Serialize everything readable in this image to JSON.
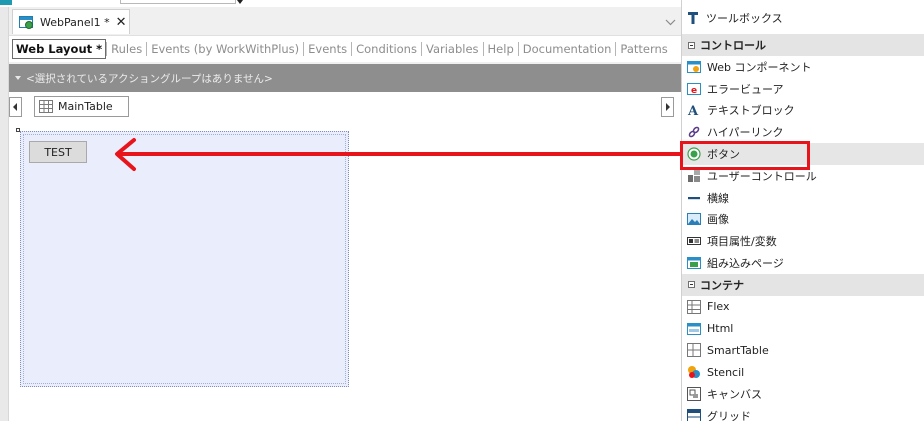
{
  "editor": {
    "doc_tab": {
      "title": "WebPanel1",
      "modified": "*",
      "close": "✕"
    },
    "collapse_icon": "chevron-down-icon",
    "subtabs": [
      {
        "label": "Web Layout *",
        "active": true
      },
      {
        "label": "Rules",
        "active": false
      },
      {
        "label": "Events (by WorkWithPlus)",
        "active": false
      },
      {
        "label": "Events",
        "active": false
      },
      {
        "label": "Conditions",
        "active": false
      },
      {
        "label": "Variables",
        "active": false
      },
      {
        "label": "Help",
        "active": false
      },
      {
        "label": "Documentation",
        "active": false
      },
      {
        "label": "Patterns",
        "active": false
      }
    ],
    "action_bar_text": "<選択されているアクショングループはありません>",
    "breadcrumb": "MainTable",
    "test_button_label": "TEST"
  },
  "toolbox": {
    "title": "ツールボックス",
    "sections": [
      {
        "label": "コントロール",
        "items": [
          {
            "label": "Web コンポーネント",
            "icon": "web-component-icon"
          },
          {
            "label": "エラービューア",
            "icon": "error-viewer-icon"
          },
          {
            "label": "テキストブロック",
            "icon": "text-block-icon"
          },
          {
            "label": "ハイパーリンク",
            "icon": "hyperlink-icon"
          },
          {
            "label": "ボタン",
            "icon": "button-icon",
            "highlighted": true
          },
          {
            "label": "ユーザーコントロール",
            "icon": "user-control-icon"
          },
          {
            "label": "横線",
            "icon": "horizontal-line-icon"
          },
          {
            "label": "画像",
            "icon": "image-icon"
          },
          {
            "label": "項目属性/変数",
            "icon": "attribute-variable-icon"
          },
          {
            "label": "組み込みページ",
            "icon": "embedded-page-icon"
          }
        ]
      },
      {
        "label": "コンテナ",
        "items": [
          {
            "label": "Flex",
            "icon": "flex-grid-icon"
          },
          {
            "label": "Html",
            "icon": "html-icon"
          },
          {
            "label": "SmartTable",
            "icon": "smart-table-icon"
          },
          {
            "label": "Stencil",
            "icon": "stencil-icon"
          },
          {
            "label": "キャンバス",
            "icon": "canvas-icon"
          },
          {
            "label": "グリッド",
            "icon": "grid-icon"
          }
        ]
      }
    ]
  },
  "colors": {
    "accent": "#e8141c",
    "main_table_bg": "#eaeefc",
    "action_bar": "#8e8e8e"
  }
}
